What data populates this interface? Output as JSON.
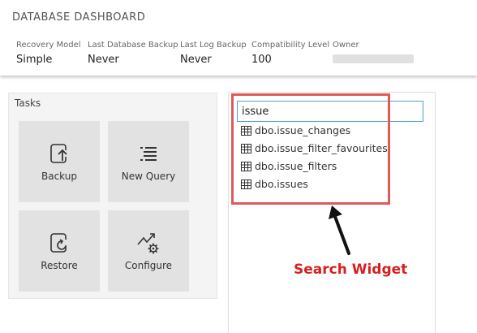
{
  "header": {
    "title": "DATABASE DASHBOARD",
    "properties": [
      {
        "label": "Recovery Model",
        "value": "Simple"
      },
      {
        "label": "Last Database Backup",
        "value": "Never"
      },
      {
        "label": "Last Log Backup",
        "value": "Never"
      },
      {
        "label": "Compatibility Level",
        "value": "100"
      },
      {
        "label": "Owner",
        "value": ""
      }
    ]
  },
  "tasks": {
    "title": "Tasks",
    "items": [
      {
        "label": "Backup",
        "icon": "backup-icon"
      },
      {
        "label": "New Query",
        "icon": "new-query-icon"
      },
      {
        "label": "Restore",
        "icon": "restore-icon"
      },
      {
        "label": "Configure",
        "icon": "configure-icon"
      }
    ]
  },
  "search_widget": {
    "query": "issue",
    "results": [
      {
        "label": "dbo.issue_changes",
        "icon": "table-icon"
      },
      {
        "label": "dbo.issue_filter_favourites",
        "icon": "table-icon"
      },
      {
        "label": "dbo.issue_filters",
        "icon": "table-icon"
      },
      {
        "label": "dbo.issues",
        "icon": "table-icon"
      }
    ]
  },
  "annotation": {
    "label": "Search Widget",
    "color": "#d81f1f",
    "box_color": "#e05a5a"
  },
  "colors": {
    "input_border": "#4aa0d8",
    "tile_bg": "#e2e2e2"
  }
}
